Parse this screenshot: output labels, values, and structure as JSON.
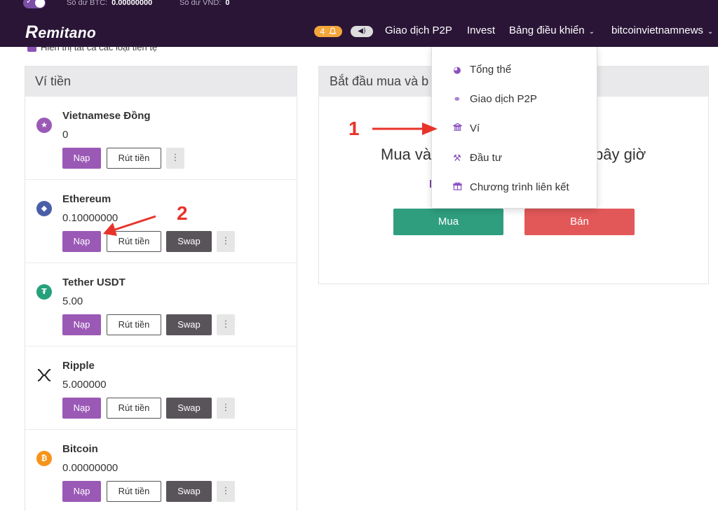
{
  "header": {
    "balance_btc_label": "Số dư BTC:",
    "balance_btc_value": "0.00000000",
    "balance_vnd_label": "Số dư VND:",
    "balance_vnd_value": "0",
    "logo_r": "R",
    "logo_rest": "emitano",
    "notifications_count": "4",
    "nav": {
      "p2p": "Giao dịch P2P",
      "invest": "Invest",
      "dashboard": "Bảng điều khiển",
      "user": "bitcoinvietnamnews"
    }
  },
  "show_all_label": "Hiển thị tất cả các loại tiền tệ",
  "wallet": {
    "title": "Ví tiền",
    "coins": [
      {
        "name": "Vietnamese Đồng",
        "amount": "0",
        "icon": "star-icon",
        "color": "#9b59b6"
      },
      {
        "name": "Ethereum",
        "amount": "0.10000000",
        "icon": "ethereum-icon",
        "color": "#4a5ea8"
      },
      {
        "name": "Tether USDT",
        "amount": "5.00",
        "icon": "tether-icon",
        "color": "#26a17b"
      },
      {
        "name": "Ripple",
        "amount": "5.000000",
        "icon": "ripple-icon",
        "color": "#222222"
      },
      {
        "name": "Bitcoin",
        "amount": "0.00000000",
        "icon": "bitcoin-icon",
        "color": "#f7931a"
      }
    ],
    "buttons": {
      "deposit": "Nạp",
      "withdraw": "Rút tiền",
      "swap": "Swap"
    }
  },
  "buy_panel": {
    "title": "Bắt đầu mua và b",
    "headline_left": "Mua và",
    "headline_right": "bây giờ",
    "buy_label": "Mua",
    "sell_label": "Bán",
    "buy_color": "#2f9e7f",
    "sell_color": "#e25858"
  },
  "dropdown": {
    "items": [
      {
        "label": "Tổng thể",
        "icon": "dashboard-gauge-icon"
      },
      {
        "label": "Giao dịch P2P",
        "icon": "handshake-icon"
      },
      {
        "label": "Ví",
        "icon": "bank-icon"
      },
      {
        "label": "Đầu tư",
        "icon": "gavel-icon"
      },
      {
        "label": "Chương trình liên kết",
        "icon": "gift-icon"
      }
    ]
  },
  "annotations": {
    "step1": "1",
    "step2": "2"
  },
  "colors": {
    "header_bg": "#2a1537",
    "accent": "#9b59b6",
    "annotation": "#e8332a"
  }
}
